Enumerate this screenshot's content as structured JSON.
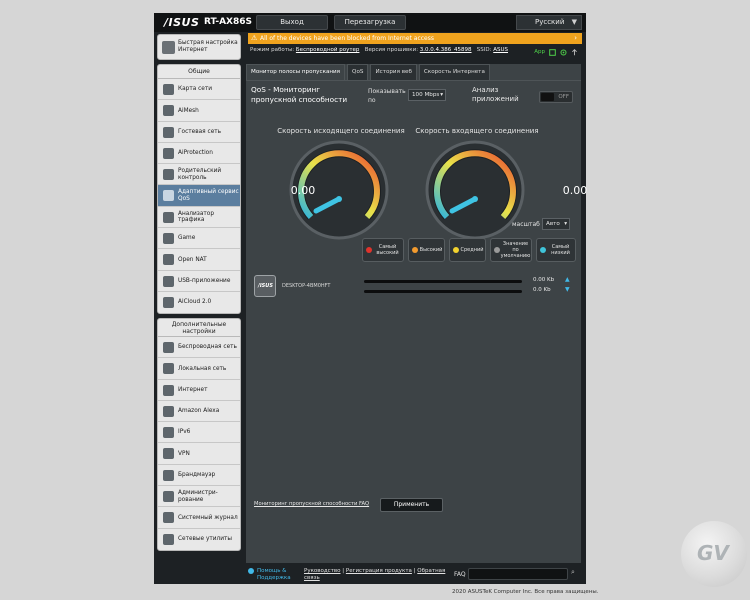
{
  "header": {
    "logo": "/ISUS",
    "model": "RT-AX86S",
    "logout": "Выход",
    "reboot": "Перезагрузка",
    "language": "Русский"
  },
  "alert": "All of the devices have been blocked from Internet access",
  "status": {
    "mode_label": "Режим работы:",
    "mode_value": "Беспроводной роутер",
    "fw_label": "Версия прошивки:",
    "fw_value": "3.0.0.4.386_45898",
    "ssid_label": "SSID:",
    "ssid_value": "ASUS",
    "app_label": "App"
  },
  "sidebar": {
    "quick": "Быстрая настройка Интернет",
    "general_head": "Общие",
    "general": [
      {
        "label": "Карта сети"
      },
      {
        "label": "AiMesh"
      },
      {
        "label": "Гостевая сеть"
      },
      {
        "label": "AiProtection"
      },
      {
        "label": "Родительский контроль"
      },
      {
        "label": "Адаптивный сервис QoS"
      },
      {
        "label": "Анализатор трафика"
      },
      {
        "label": "Game"
      },
      {
        "label": "Open NAT"
      },
      {
        "label": "USB-приложение"
      },
      {
        "label": "AiCloud 2.0"
      }
    ],
    "advanced_head": "Дополнительные настройки",
    "advanced": [
      {
        "label": "Беспроводная сеть"
      },
      {
        "label": "Локальная сеть"
      },
      {
        "label": "Интернет"
      },
      {
        "label": "Amazon Alexa"
      },
      {
        "label": "IPv6"
      },
      {
        "label": "VPN"
      },
      {
        "label": "Брандмауэр"
      },
      {
        "label": "Администри-рование"
      },
      {
        "label": "Системный журнал"
      },
      {
        "label": "Сетевые утилиты"
      }
    ]
  },
  "tabs": [
    {
      "label": "Монитор полосы пропускания"
    },
    {
      "label": "QoS"
    },
    {
      "label": "История веб"
    },
    {
      "label": "Скорость Интернета"
    }
  ],
  "qos": {
    "title": "QoS - Мониторинг пропускной способности",
    "show_label": "Показывать по",
    "speed_value": "100 Mbps",
    "app_analysis": "Анализ приложений",
    "toggle_state": "OFF",
    "upload_label": "Скорость исходящего соединения",
    "download_label": "Скорость входящего соединения",
    "upload_value": "0.00",
    "download_value": "0.00",
    "scale_label": "масштаб",
    "scale_value": "Авто",
    "legend": [
      {
        "label": "Самый высокий",
        "color": "#e0332c"
      },
      {
        "label": "Высокий",
        "color": "#f29a2e"
      },
      {
        "label": "Средний",
        "color": "#f2d22e"
      },
      {
        "label": "Значение по умолчанию",
        "color": "#9a9a9a"
      },
      {
        "label": "Самый низкий",
        "color": "#3fc4d9"
      }
    ],
    "device_logo": "/ISUS",
    "device_name": "DESKTOP-4BM0HFT",
    "device_up": "0.00 Kb",
    "device_down": "0.0 Kb",
    "faq_link": "Мониторинг пропускной способности FAQ",
    "apply": "Применить"
  },
  "footer": {
    "help": "Помощь & Поддержка",
    "link1": "Руководство",
    "link2": "Регистрация продукта",
    "link3": "Обратная связь",
    "faq": "FAQ",
    "copyright": "2020 ASUSTeK Computer Inc. Все права защищены."
  },
  "watermark": "GV",
  "colors": {
    "accent": "#41b9e8",
    "alert": "#f0a31e",
    "active_item": "#5b7e9f"
  }
}
